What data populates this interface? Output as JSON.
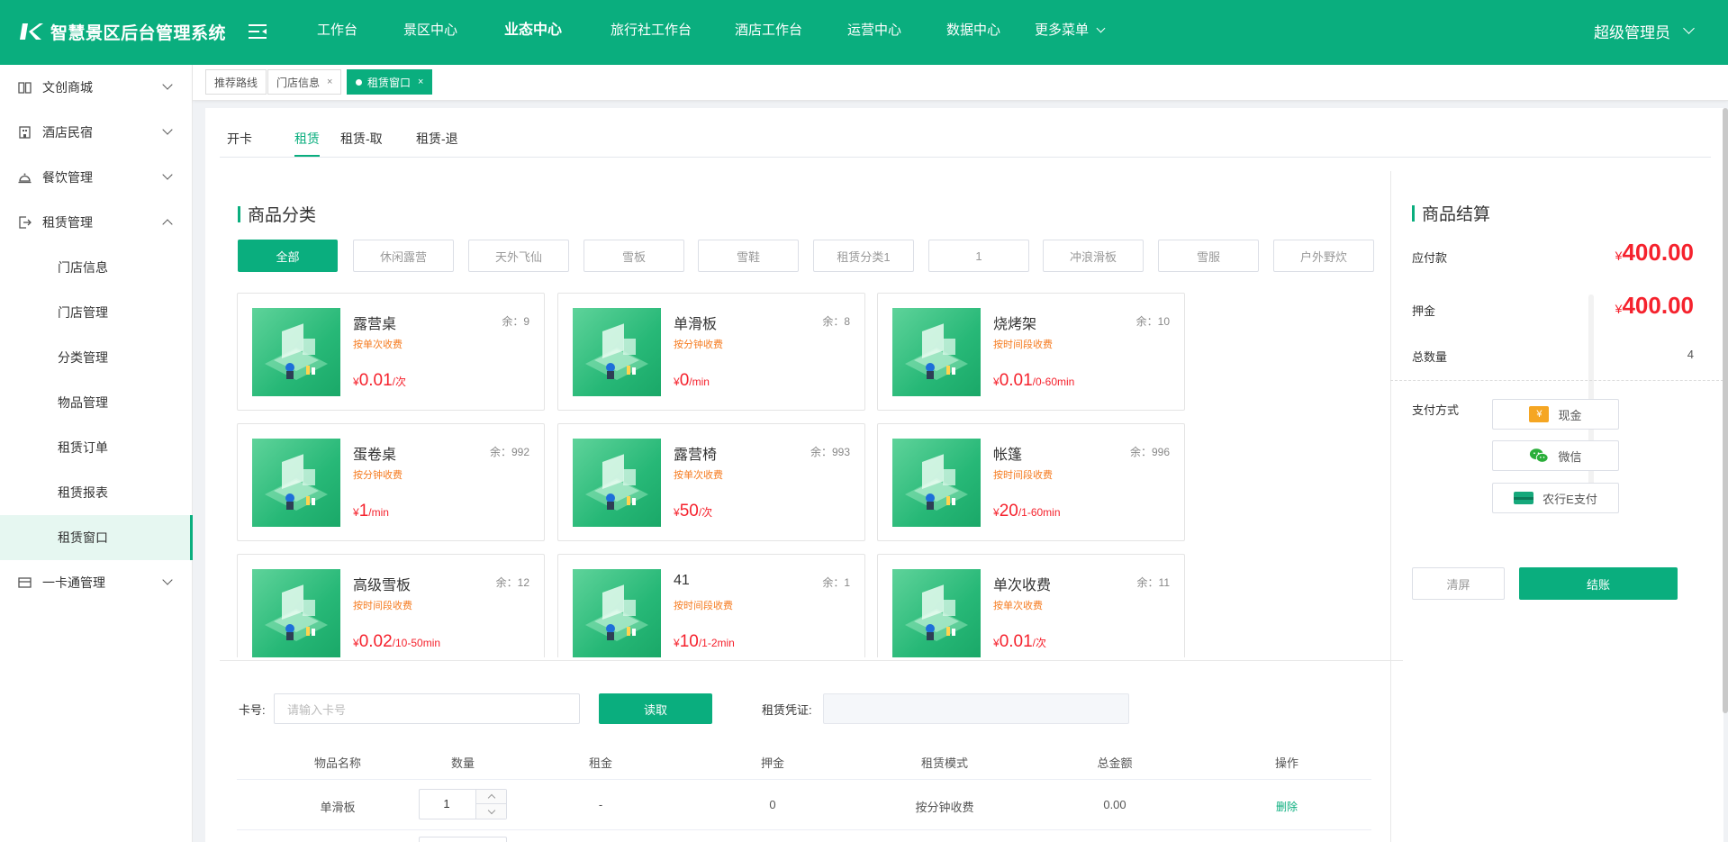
{
  "app": {
    "title": "智慧景区后台管理系统",
    "accent": "#0aae7e",
    "price_color": "#f5222d",
    "mode_color": "#f57b20"
  },
  "header": {
    "nav": [
      "工作台",
      "景区中心",
      "业态中心",
      "旅行社工作台",
      "酒店工作台",
      "运营中心",
      "数据中心",
      "更多菜单"
    ],
    "user": "超级管理员"
  },
  "sidebar": {
    "items": [
      {
        "label": "文创商城",
        "icon": "book-icon"
      },
      {
        "label": "酒店民宿",
        "icon": "building-icon"
      },
      {
        "label": "餐饮管理",
        "icon": "cloche-icon"
      },
      {
        "label": "租赁管理",
        "icon": "exit-icon"
      },
      {
        "label": "一卡通管理",
        "icon": "card-icon"
      }
    ],
    "sub_items": [
      "门店信息",
      "门店管理",
      "分类管理",
      "物品管理",
      "租赁订单",
      "租赁报表",
      "租赁窗口"
    ]
  },
  "tags": [
    {
      "label": "推荐路线"
    },
    {
      "label": "门店信息"
    },
    {
      "label": "租赁窗口"
    }
  ],
  "tabs": [
    "开卡",
    "租赁",
    "租赁-取",
    "租赁-退"
  ],
  "categories": {
    "title": "商品分类",
    "items": [
      "全部",
      "休闲露营",
      "天外飞仙",
      "雪板",
      "雪鞋",
      "租赁分类1",
      "1",
      "冲浪滑板",
      "雪服",
      "户外野炊"
    ]
  },
  "products": [
    {
      "name": "露营桌",
      "stock": "余：9",
      "mode": "按单次收费",
      "currency": "¥",
      "price": "0.01",
      "unit": "/次"
    },
    {
      "name": "单滑板",
      "stock": "余：8",
      "mode": "按分钟收费",
      "currency": "¥",
      "price": "0",
      "unit": "/min"
    },
    {
      "name": "烧烤架",
      "stock": "余：10",
      "mode": "按时间段收费",
      "currency": "¥",
      "price": "0.01",
      "unit": "/0-60min"
    },
    {
      "name": "蛋卷桌",
      "stock": "余：992",
      "mode": "按分钟收费",
      "currency": "¥",
      "price": "1",
      "unit": "/min"
    },
    {
      "name": "露营椅",
      "stock": "余：993",
      "mode": "按单次收费",
      "currency": "¥",
      "price": "50",
      "unit": "/次"
    },
    {
      "name": "帐篷",
      "stock": "余：996",
      "mode": "按时间段收费",
      "currency": "¥",
      "price": "20",
      "unit": "/1-60min"
    },
    {
      "name": "高级雪板",
      "stock": "余：12",
      "mode": "按时间段收费",
      "currency": "¥",
      "price": "0.02",
      "unit": "/10-50min"
    },
    {
      "name": "41",
      "stock": "余：1",
      "mode": "按时间段收费",
      "currency": "¥",
      "price": "10",
      "unit": "/1-2min"
    },
    {
      "name": "单次收费",
      "stock": "余：11",
      "mode": "按单次收费",
      "currency": "¥",
      "price": "0.01",
      "unit": "/次"
    }
  ],
  "card_form": {
    "card_label": "卡号:",
    "card_placeholder": "请输入卡号",
    "read_button": "读取",
    "voucher_label": "租赁凭证:"
  },
  "table": {
    "headers": [
      "物品名称",
      "数量",
      "租金",
      "押金",
      "租赁模式",
      "总金额",
      "操作"
    ],
    "rows": [
      {
        "name": "单滑板",
        "quantity": "1",
        "rent": "-",
        "deposit": "0",
        "mode": "按分钟收费",
        "total": "0.00",
        "action": "删除"
      }
    ]
  },
  "settlement": {
    "title": "商品结算",
    "payable_label": "应付款",
    "payable_currency": "¥",
    "payable": "400.00",
    "deposit_label": "押金",
    "deposit_currency": "¥",
    "deposit": "400.00",
    "count_label": "总数量",
    "count": "4",
    "payment_label": "支付方式",
    "payment_methods": [
      {
        "label": "现金",
        "icon": "cash-icon",
        "icon_text": "¥",
        "color": "#f5a623"
      },
      {
        "label": "微信",
        "icon": "wechat-icon",
        "color": "#2aae3a"
      },
      {
        "label": "农行E支付",
        "icon": "bank-card-icon",
        "color": "#16a87b"
      }
    ],
    "clear_button": "清屏",
    "checkout_button": "结账"
  }
}
